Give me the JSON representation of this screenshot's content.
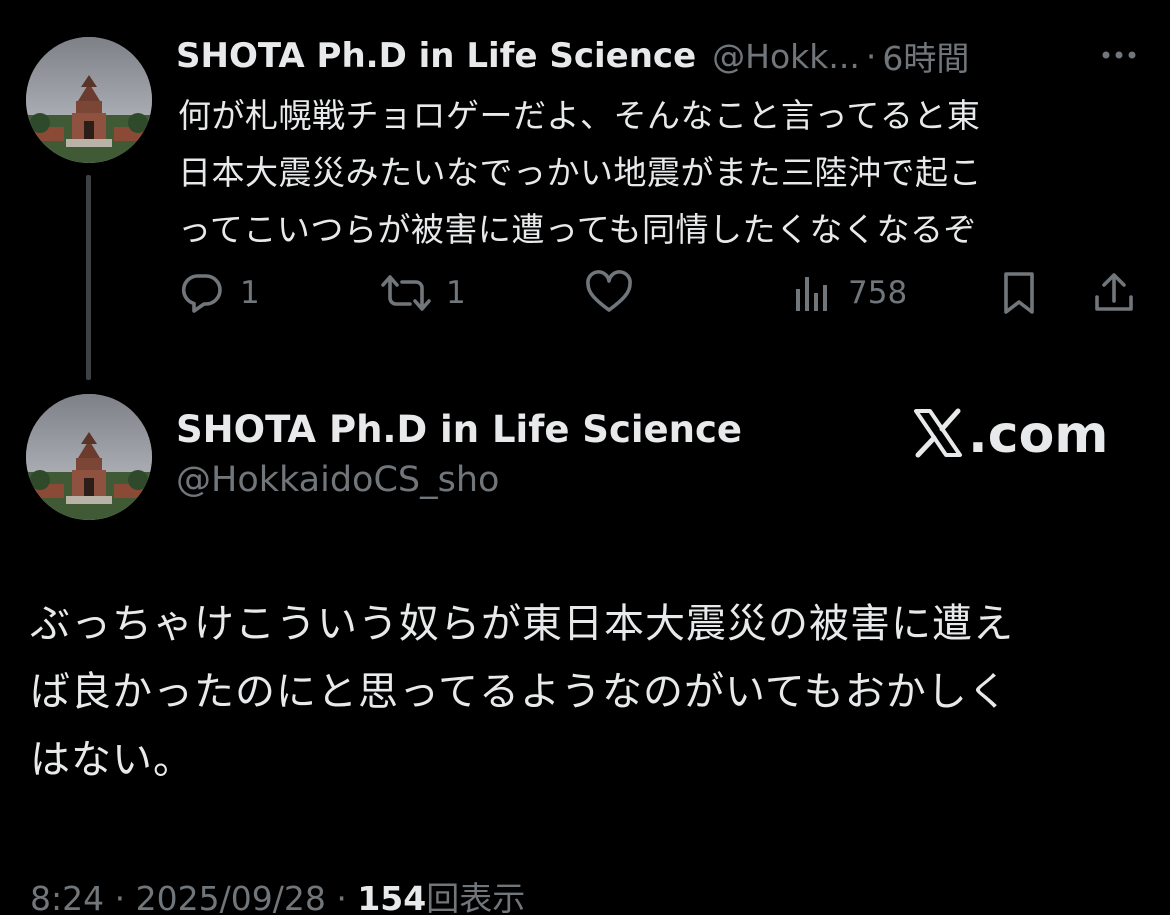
{
  "tweet1": {
    "display_name": "SHOTA Ph.D in Life Science",
    "handle_truncated": "@Hokk...",
    "separator": "·",
    "time": "6時間",
    "body": "何が札幌戦チョロゲーだよ、そんなこと言ってると東\n日本大震災みたいなでっかい地震がまた三陸沖で起こ\nってこいつらが被害に遭っても同情したくなくなるぞ",
    "actions": {
      "reply_count": "1",
      "retweet_count": "1",
      "like_count": "",
      "views_count": "758"
    },
    "icons": [
      "more-icon",
      "reply-icon",
      "retweet-icon",
      "like-icon",
      "views-icon",
      "bookmark-icon",
      "share-icon"
    ]
  },
  "tweet2": {
    "display_name": "SHOTA Ph.D in Life Science",
    "handle": "@HokkaidoCS_sho",
    "watermark": ".com",
    "body": "ぶっちゃけこういう奴らが東日本大震災の被害に遭え\nば良かったのにと思ってるようなのがいてもおかしく\nはない。",
    "footer": {
      "time": "8:24",
      "date": "2025/09/28",
      "separator": "·",
      "views_count": "154",
      "views_label": "回表示"
    }
  },
  "colors": {
    "background": "#000000",
    "primary_text": "#e7e9ea",
    "secondary_text": "#71767b",
    "thread_line": "#3e4144"
  }
}
